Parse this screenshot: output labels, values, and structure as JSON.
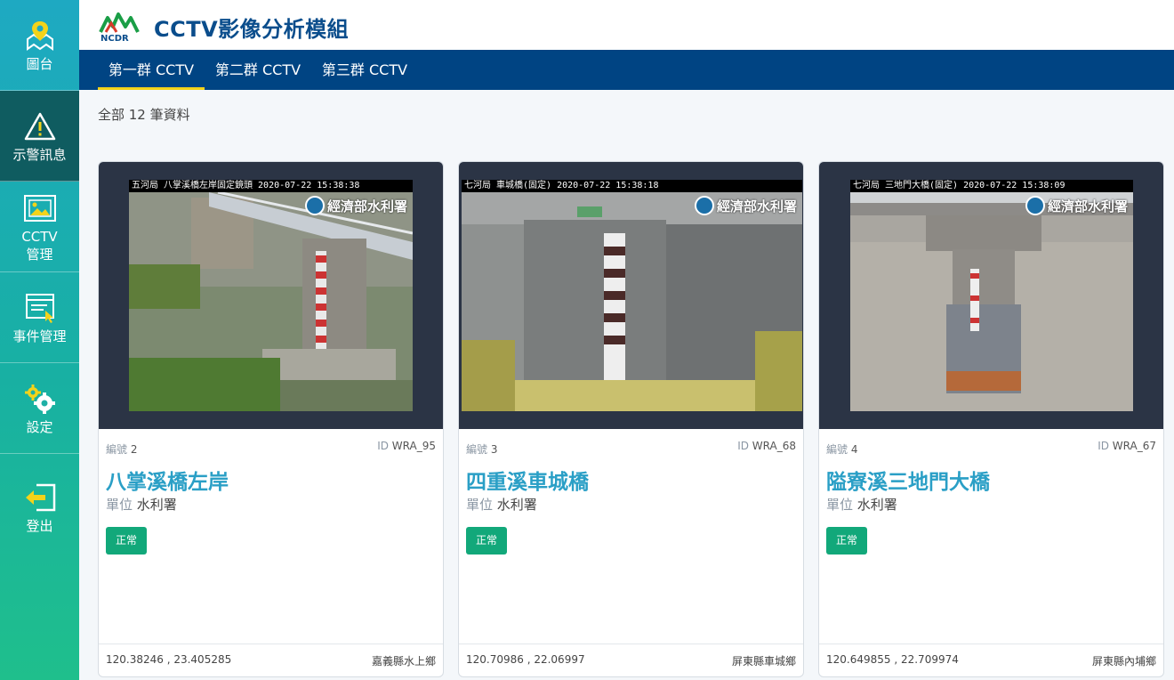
{
  "app": {
    "title": "CCTV影像分析模組",
    "logo_text": "NCDR"
  },
  "sidebar": {
    "items": [
      {
        "label": "圖台",
        "icon": "map-pin-icon"
      },
      {
        "label": "示警訊息",
        "icon": "warning-icon"
      },
      {
        "label": "CCTV\n管理",
        "label_line1": "CCTV",
        "label_line2": "管理",
        "icon": "image-icon"
      },
      {
        "label": "事件管理",
        "icon": "event-icon"
      },
      {
        "label": "設定",
        "icon": "gear-icon"
      },
      {
        "label": "登出",
        "icon": "logout-icon"
      }
    ]
  },
  "tabs": [
    {
      "label": "第一群 CCTV",
      "active": true
    },
    {
      "label": "第二群 CCTV",
      "active": false
    },
    {
      "label": "第三群 CCTV",
      "active": false
    }
  ],
  "summary": {
    "text": "全部 12 筆資料"
  },
  "labels": {
    "number": "編號",
    "id": "ID",
    "unit": "單位"
  },
  "colors": {
    "accent": "#2a9fc6",
    "nav": "#004483",
    "status_ok": "#12a87a",
    "tab_underline": "#f3d31a"
  },
  "cards": [
    {
      "number": "2",
      "id": "WRA_95",
      "name": "八掌溪橋左岸",
      "unit": "水利署",
      "status": "正常",
      "osd": "五河局 八掌溪橋左岸固定鏡頭 2020-07-22 15:38:38",
      "watermark": "經濟部水利署",
      "coords": "120.38246 , 23.405285",
      "location": "嘉義縣水上鄉"
    },
    {
      "number": "3",
      "id": "WRA_68",
      "name": "四重溪車城橋",
      "unit": "水利署",
      "status": "正常",
      "osd": "七河局 車城橋(固定) 2020-07-22 15:38:18",
      "watermark": "經濟部水利署",
      "coords": "120.70986 , 22.06997",
      "location": "屏東縣車城鄉"
    },
    {
      "number": "4",
      "id": "WRA_67",
      "name": "隘寮溪三地門大橋",
      "unit": "水利署",
      "status": "正常",
      "osd": "七河局 三地門大橋(固定) 2020-07-22 15:38:09",
      "watermark": "經濟部水利署",
      "coords": "120.649855 , 22.709974",
      "location": "屏東縣內埔鄉"
    }
  ]
}
